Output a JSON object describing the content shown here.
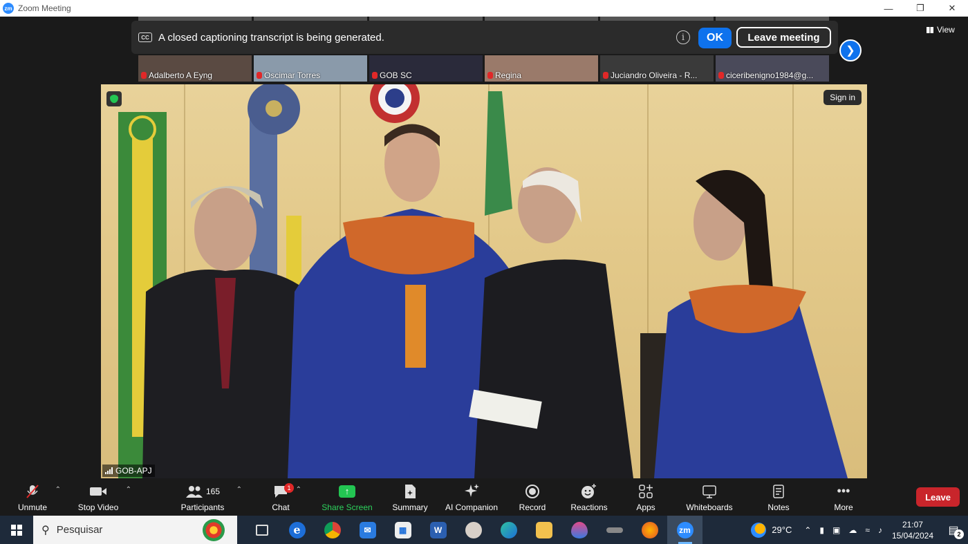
{
  "window": {
    "title": "Zoom Meeting",
    "app_icon": "zm"
  },
  "caption_banner": {
    "cc_icon": "CC",
    "message": "A closed captioning transcript is being generated.",
    "info_icon": "i",
    "ok_label": "OK",
    "leave_label": "Leave meeting"
  },
  "view_label": "View",
  "thumbnails": [
    {
      "name": "Adalberto A Eyng",
      "color": "#5a4a42"
    },
    {
      "name": "Oscimar Torres",
      "color": "#8a9aaa"
    },
    {
      "name": "GOB SC",
      "color": "#2a2a3a"
    },
    {
      "name": "Regina",
      "color": "#9a7a6a"
    },
    {
      "name": "Juciandro Oliveira - R...",
      "color": "#3a3a3a"
    },
    {
      "name": "ciceribenigno1984@g...",
      "color": "#4a4a5a"
    }
  ],
  "main_video": {
    "speaker": "GOB-APJ",
    "sign_in": "Sign in"
  },
  "toolbar": {
    "unmute": "Unmute",
    "stop_video": "Stop Video",
    "participants": "Participants",
    "participants_count": "165",
    "chat": "Chat",
    "chat_badge": "1",
    "share_screen": "Share Screen",
    "summary": "Summary",
    "ai_companion": "AI Companion",
    "record": "Record",
    "reactions": "Reactions",
    "apps": "Apps",
    "whiteboards": "Whiteboards",
    "notes": "Notes",
    "more": "More",
    "leave": "Leave"
  },
  "taskbar": {
    "search_placeholder": "Pesquisar",
    "zoom_label": "zm",
    "temperature": "29°C",
    "time": "21:07",
    "date": "15/04/2024",
    "notifications": "2"
  },
  "colors": {
    "accent": "#0e72ed",
    "leave": "#c9252b",
    "share": "#23c552"
  }
}
